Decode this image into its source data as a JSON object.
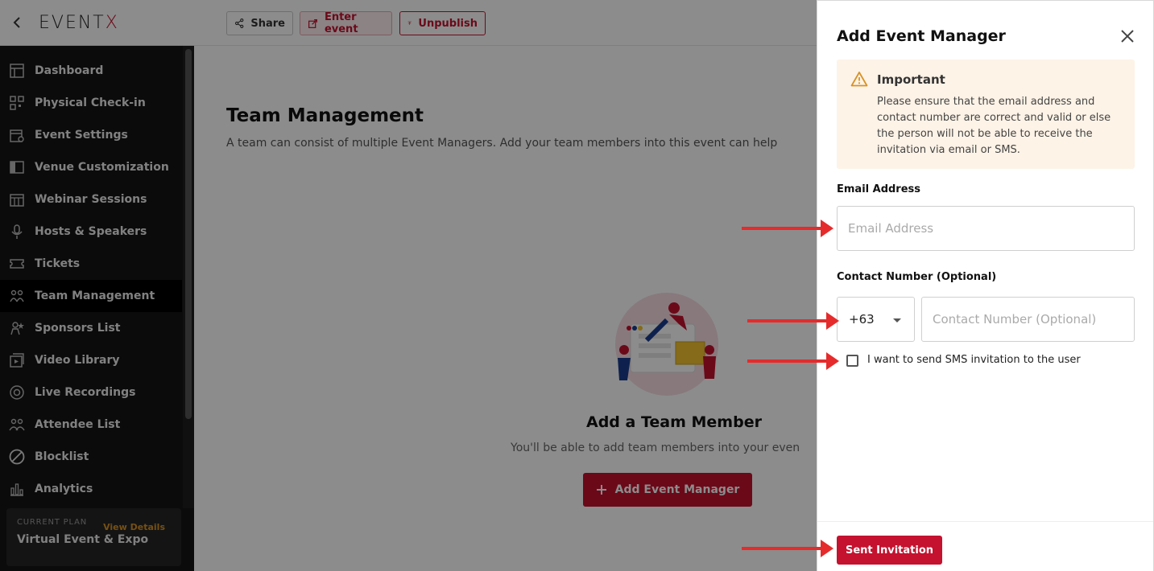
{
  "topbar": {
    "logo_main": "EVENT",
    "logo_accent": "X",
    "share_label": "Share",
    "enter_label": "Enter event",
    "unpublish_label": "Unpublish"
  },
  "sidebar": {
    "items": [
      {
        "label": "Dashboard",
        "icon": "dashboard-icon"
      },
      {
        "label": "Physical Check-in",
        "icon": "qr-code-icon"
      },
      {
        "label": "Event Settings",
        "icon": "calendar-settings-icon"
      },
      {
        "label": "Venue Customization",
        "icon": "layout-icon"
      },
      {
        "label": "Webinar Sessions",
        "icon": "calendar-grid-icon"
      },
      {
        "label": "Hosts & Speakers",
        "icon": "microphone-icon"
      },
      {
        "label": "Tickets",
        "icon": "ticket-icon"
      },
      {
        "label": "Team Management",
        "icon": "team-icon"
      },
      {
        "label": "Sponsors List",
        "icon": "sponsor-icon"
      },
      {
        "label": "Video Library",
        "icon": "video-library-icon"
      },
      {
        "label": "Live Recordings",
        "icon": "record-icon"
      },
      {
        "label": "Attendee List",
        "icon": "attendees-icon"
      },
      {
        "label": "Blocklist",
        "icon": "block-icon"
      },
      {
        "label": "Analytics",
        "icon": "analytics-icon"
      }
    ],
    "active_index": 7,
    "plan": {
      "label": "CURRENT PLAN",
      "view_details": "View Details",
      "name": "Virtual Event & Expo"
    }
  },
  "main": {
    "title": "Team Management",
    "description": "A team can consist of multiple Event Managers. Add your team members into this event can help",
    "empty_title": "Add a Team Member",
    "empty_description": "You'll be able to add team members into your even",
    "add_button": "Add Event Manager"
  },
  "drawer": {
    "title": "Add Event Manager",
    "alert_title": "Important",
    "alert_body": "Please ensure that the email address and contact number are correct and valid or else the person will not be able to receive the invitation via email or SMS.",
    "email_label": "Email Address",
    "email_placeholder": "Email Address",
    "contact_label": "Contact Number (Optional)",
    "country_code": "+63",
    "contact_placeholder": "Contact Number (Optional)",
    "sms_checkbox_label": "I want to send SMS invitation to the user",
    "sms_checked": false,
    "submit_label": "Sent Invitation"
  },
  "colors": {
    "brand": "#c4122f",
    "sidebar_bg": "#141414",
    "alert_bg": "#fdf3e7",
    "annotation_arrow": "#e52b2b",
    "plan_link": "#d89224"
  }
}
